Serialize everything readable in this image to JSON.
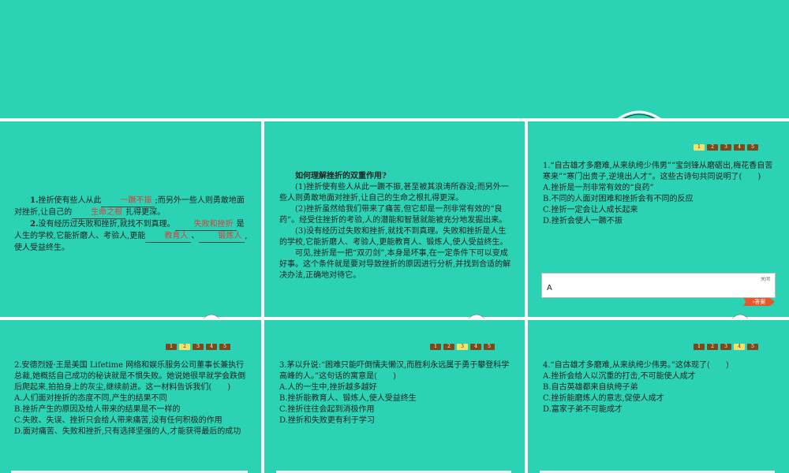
{
  "panel1": {
    "q1_num": "1.",
    "q1_a": "挫折使有些人从此",
    "q1_b1": "一蹶不振",
    "q1_c": ";而另外一些人则勇敢地面对挫折,让自己的",
    "q1_b2": "生命之根",
    "q1_d": "扎得更深。",
    "q2_num": "2.",
    "q2_a": "没有经历过失败和挫折,就找不到真理。",
    "q2_b1": "失败和挫折",
    "q2_c": "是人生的学校,它能折磨人、考验人,更能",
    "q2_b2": "教育人",
    "q2_sep": "、",
    "q2_b3": "锻炼人",
    "q2_d": ",使人受益终生。"
  },
  "panel2": {
    "title": "如何理解挫折的双重作用?",
    "p1": "(1)挫折使有些人从此一蹶不振,甚至被其浪涛所吞没;而另外一些人则勇敢地面对挫折,让自己的生命之根扎得更深。",
    "p2": "(2)挫折虽然给我们带来了痛苦,但它却是一剂非常有效的“良药”。经受住挫折的考验,人的潜能和智慧就能被充分地发掘出来。",
    "p3": "(3)没有经历过失败和挫折,就找不到真理。失败和挫折是人生的学校,它能折磨人、考验人,更能教育人、锻炼人,使人受益终生。",
    "p4": "可见,挫折是一把“双刃剑”,本身是坏事,在一定条件下可以变成好事。这个条件就是要对导致挫折的原因进行分析,并找到合适的解决办法,正确地对待它。"
  },
  "pager_labels": [
    "1",
    "2",
    "3",
    "4",
    "5"
  ],
  "panel3": {
    "active_page": 1,
    "stem": "1.“自古雄才多磨难,从来纨绔少伟男”“宝剑锋从磨砺出,梅花香自苦寒来”“寒门出贵子,逆境出人才”。这些古诗句共同说明了(　　)",
    "options": [
      "A.挫折是一剂非常有效的“良药”",
      "B.不同的人面对困难和挫折会有不同的反应",
      "C.挫折一定会让人成长起来",
      "D.挫折会使人一蹶不振"
    ],
    "answer_value": "A",
    "close_label": "关闭",
    "answer_button": "答案"
  },
  "panel4": {
    "active_page": 2,
    "stem": "2.安德烈娅·王是美国 Lifetime 网络和娱乐服务公司董事长兼执行总裁,她概括自己成功的秘诀就是不惧失败。她说她很早就学会跌倒后爬起来,拍拍身上的灰尘,继续前进。这一材料告诉我们(　　)",
    "options": [
      "A.人们面对挫折的态度不同,产生的结果不同",
      "B.挫折产生的原因及给人带来的结果是不一样的",
      "C.失败、失误、挫折只会给人带来痛苦,没有任何积极的作用",
      "D.面对痛苦、失败和挫折,只有选择坚强的人,才能获得最后的成功"
    ]
  },
  "panel5": {
    "active_page": 3,
    "stem": "3.茅以升说:“困难只能吓倒懦夫懒汉,而胜利永远属于勇于攀登科学高峰的人。”这句话的寓意是(　　)",
    "options": [
      "A.人的一生中,挫折越多越好",
      "B.挫折能教育人、锻炼人,使人受益终生",
      "C.挫折往往会起到消极作用",
      "D.挫折和失败更有利于学习"
    ]
  },
  "panel6": {
    "active_page": 4,
    "stem": "4.“自古雄才多磨难,从来纨绔少伟男。”这体现了(　　)",
    "options": [
      "A.挫折会给人以沉重的打击,不可能使人成才",
      "B.自古英雄都来自纨绔子弟",
      "C.挫折能磨炼人的意志,促使人成才",
      "D.富家子弟不可能成才"
    ]
  },
  "colors": {
    "background": "#2bd2b3",
    "fill_blank": "#d64040",
    "pager_dot": "#7a4a1c",
    "pager_active": "#f6e06a",
    "answer_button": "#e8562b"
  }
}
